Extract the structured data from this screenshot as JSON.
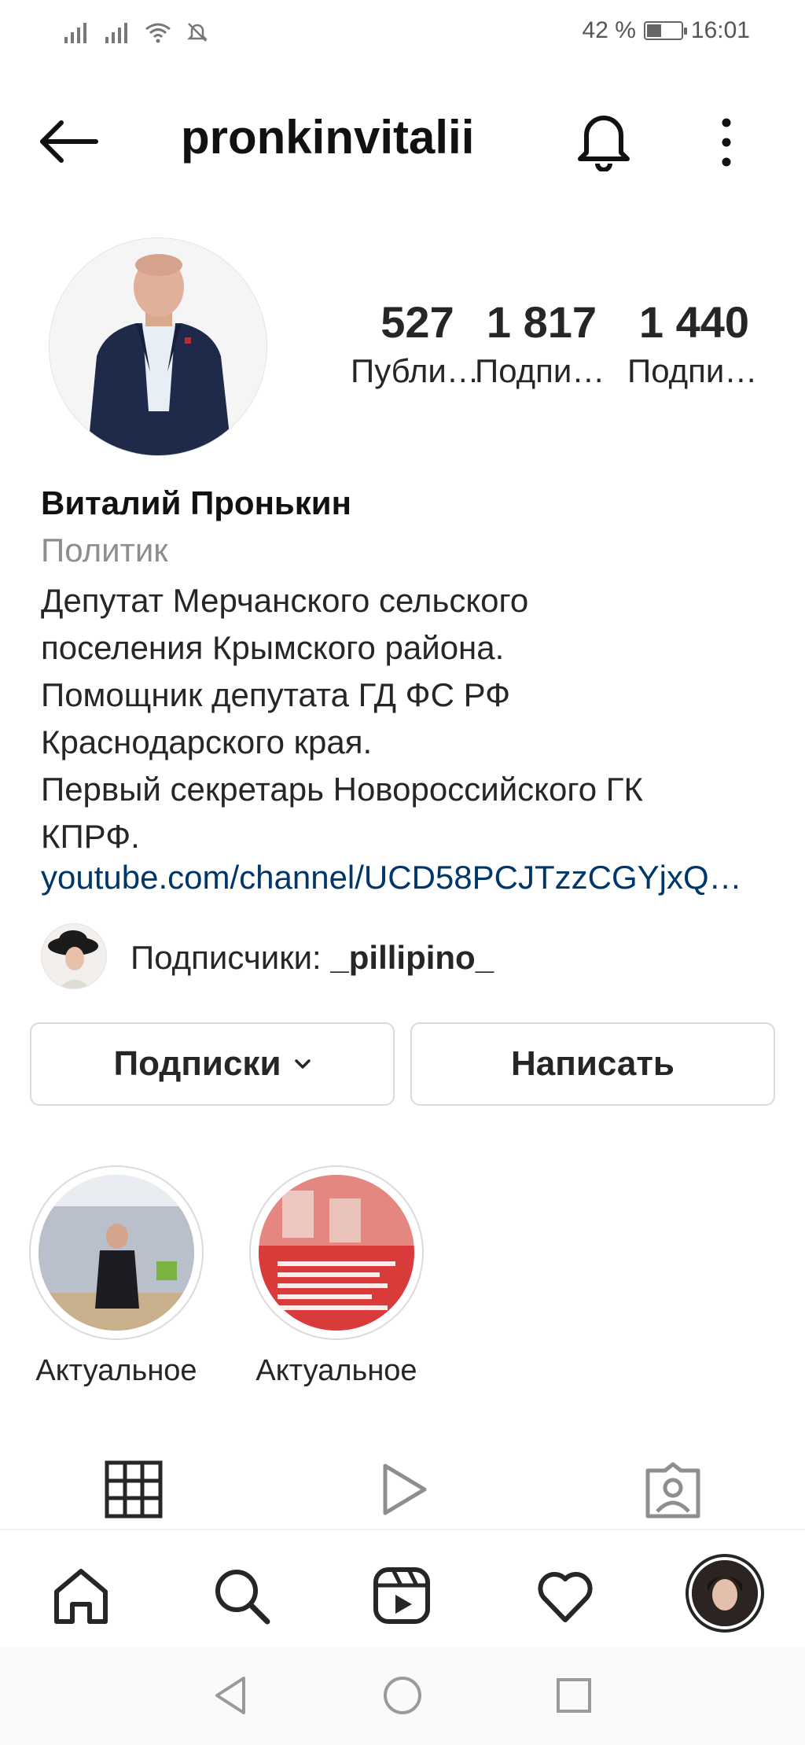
{
  "status_bar": {
    "battery": "42 %",
    "battery_level": 0.42,
    "time": "16:01"
  },
  "header": {
    "username": "pronkinvitalii"
  },
  "stats": [
    {
      "value": "527",
      "label": "Публикации"
    },
    {
      "value": "1 817",
      "label": "Подписчики"
    },
    {
      "value": "1 440",
      "label": "Подписки"
    }
  ],
  "profile": {
    "name": "Виталий Пронькин",
    "category": "Политик",
    "bio": "Депутат Мерчанского сельского\nпоселения Крымского района.\nПомощник депутата ГД ФС РФ\nКраснодарского края.\nПервый секретарь Новороссийского  ГК\nКПРФ.",
    "link": "youtube.com/channel/UCD58PCJTzzCGYjxQ…"
  },
  "followed_by": {
    "prefix": "Подписчики: ",
    "user": "_pillipino_"
  },
  "actions": {
    "following_label": "Подписки",
    "message_label": "Написать"
  },
  "highlights": [
    {
      "caption": "Актуальное"
    },
    {
      "caption": "Актуальное"
    }
  ],
  "tabs": [
    "grid-icon",
    "reels-play-icon",
    "tagged-icon"
  ],
  "bottom_nav": [
    "home-icon",
    "search-icon",
    "reels-icon",
    "heart-icon",
    "profile-avatar"
  ],
  "colors": {
    "link": "#00376b",
    "secondary_text": "#8e8e8e",
    "border": "#dbdbdb",
    "highlight_red": "#d93a3a"
  }
}
